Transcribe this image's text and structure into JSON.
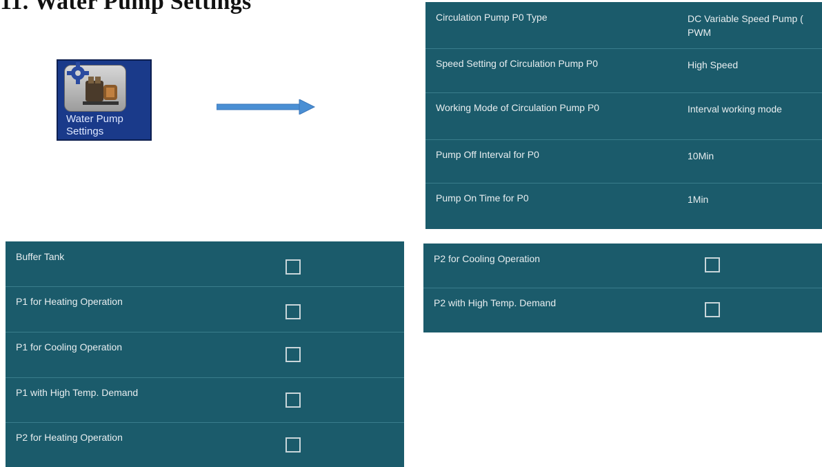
{
  "page": {
    "heading": "11. Water Pump Settings"
  },
  "app_icon": {
    "label_line1": "Water Pump",
    "label_line2": "Settings",
    "icon": "water-pump-settings-icon"
  },
  "arrow_icon": "right-arrow-icon",
  "circulation_settings": [
    {
      "name": "Circulation Pump P0 Type",
      "value": "DC Variable Speed Pump ( PWM"
    },
    {
      "name": "Speed Setting of Circulation Pump P0",
      "value": "High Speed"
    },
    {
      "name": "Working Mode of Circulation Pump P0",
      "value": "Interval working mode"
    },
    {
      "name": "Pump Off Interval for P0",
      "value": "10Min"
    },
    {
      "name": "Pump On Time for P0",
      "value": "1Min"
    }
  ],
  "pump_options_left": [
    {
      "label": "Buffer Tank",
      "checked": false
    },
    {
      "label": "P1 for Heating Operation",
      "checked": false
    },
    {
      "label": "P1 for Cooling Operation",
      "checked": false
    },
    {
      "label": "P1 with High Temp. Demand",
      "checked": false
    },
    {
      "label": "P2 for Heating Operation",
      "checked": false
    }
  ],
  "pump_options_right": [
    {
      "label": "P2 for Cooling Operation",
      "checked": false
    },
    {
      "label": "P2 with High Temp. Demand",
      "checked": false
    }
  ],
  "colors": {
    "panel_background": "#1b5b6b",
    "panel_divider": "#3a7d8c",
    "icon_background": "#1a3a8a",
    "arrow": "#4a8fd4"
  }
}
